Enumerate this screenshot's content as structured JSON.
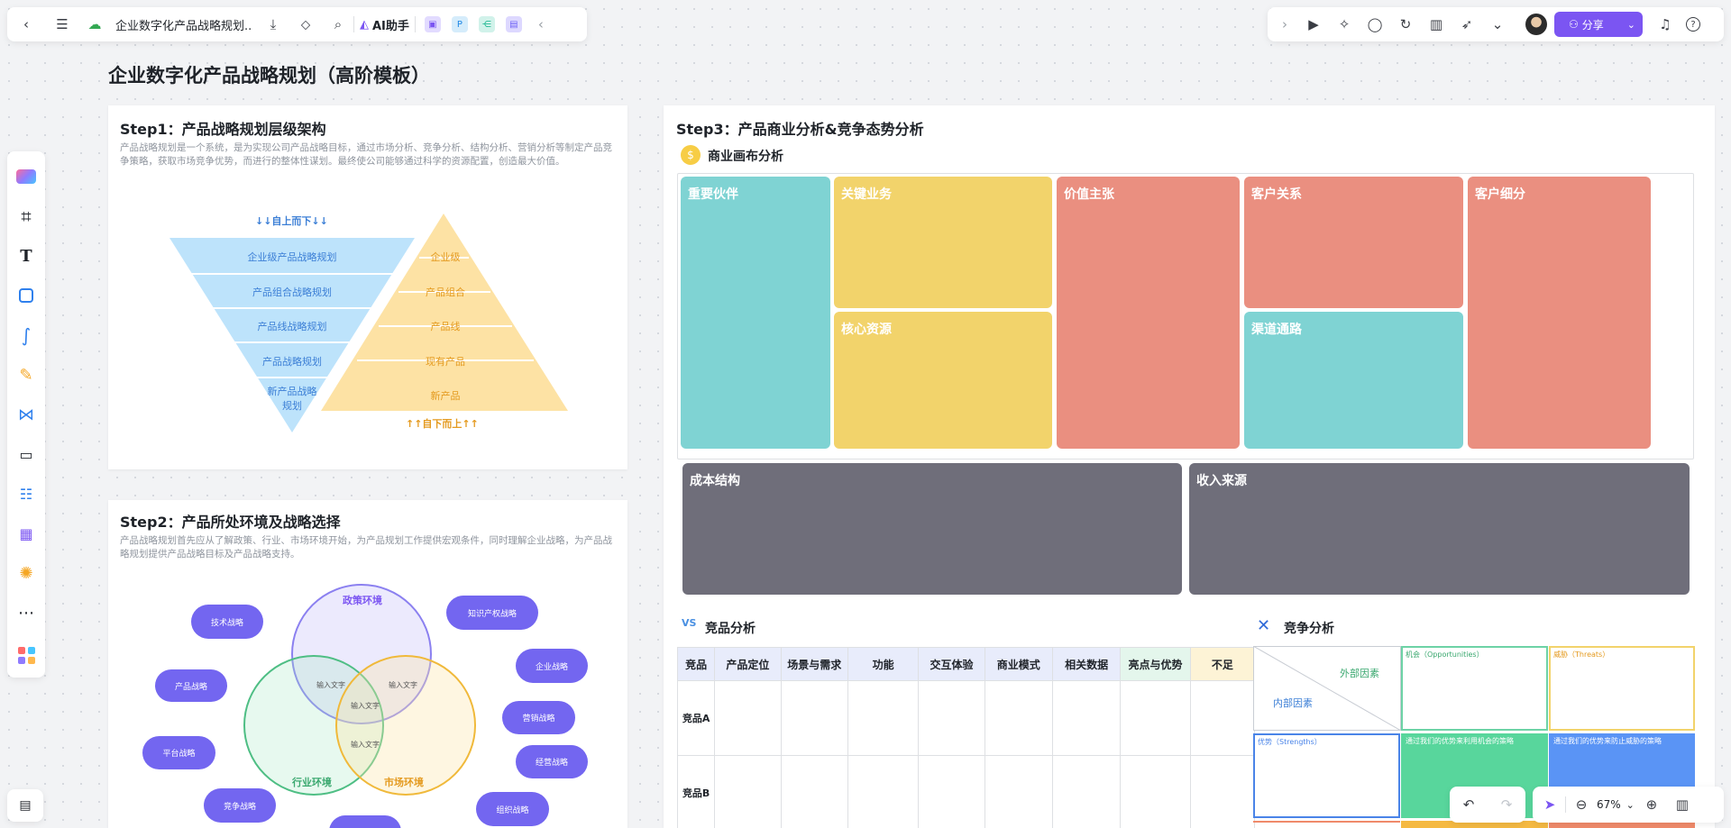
{
  "toolbar": {
    "doc_title": "企业数字化产品战略规划...",
    "ai_label": "AI助手",
    "share_label": "分享"
  },
  "page_title": "企业数字化产品战略规划（高阶模板）",
  "step1": {
    "title": "Step1：产品战略规划层级架构",
    "desc": "产品战略规划是一个系统，是为实现公司产品战略目标，通过市场分析、竞争分析、结构分析、营销分析等制定产品竞争策略，获取市场竞争优势，而进行的整体性谋划。最终使公司能够通过科学的资源配置，创造最大价值。",
    "top_down": "↓↓自上而下↓↓",
    "bottom_up": "↑↑自下而上↑↑",
    "inverted": [
      "企业级产品战略规划",
      "产品组合战略规划",
      "产品线战略规划",
      "产品战略规划",
      "新产品战略",
      "规划"
    ],
    "pyramid": [
      "企业级",
      "产品组合",
      "产品线",
      "现有产品",
      "新产品"
    ]
  },
  "step2": {
    "title": "Step2：产品所处环境及战略选择",
    "desc": "产品战略规划首先应从了解政策、行业、市场环境开始，为产品规划工作提供宏观条件，同时理解企业战略，为产品战略规划提供产品战略目标及产品战略支持。",
    "circles": [
      "政策环境",
      "行业环境",
      "市场环境"
    ],
    "inner": [
      "输入文字",
      "输入文字",
      "输入文字",
      "输入文字"
    ],
    "pills": [
      "技术战略",
      "知识产权战略",
      "产品战略",
      "企业战略",
      "营销战略",
      "平台战略",
      "经营战略",
      "竞争战略",
      "组织战略",
      ""
    ]
  },
  "step3": {
    "title": "Step3：产品商业分析&竞争态势分析",
    "canvas_title": "商业画布分析",
    "canvas": {
      "partners": "重要伙伴",
      "activities": "关键业务",
      "resources": "核心资源",
      "value": "价值主张",
      "relations": "客户关系",
      "channels": "渠道通路",
      "segments": "客户细分",
      "cost": "成本结构",
      "revenue": "收入来源"
    },
    "competitor_title": "竞品分析",
    "competitor_headers": [
      "竞品",
      "产品定位",
      "场景与需求",
      "功能",
      "交互体验",
      "商业模式",
      "相关数据",
      "亮点与优势",
      "不足"
    ],
    "competitor_rows": [
      "竞品A",
      "竞品B"
    ],
    "competition_title": "竞争分析",
    "swot": {
      "external": "外部因素",
      "internal": "内部因素",
      "opportunities": "机会（Opportunities）",
      "threats": "威胁（Threats）",
      "strengths": "优势（Strengths）",
      "so": "通过我们的优势来利用机会的策略",
      "st": "通过我们的优势来防止威胁的策略"
    }
  },
  "zoom": {
    "level": "67%"
  },
  "colors": {
    "teal": "#7fd3d3",
    "yellow": "#f2d36b",
    "salmon": "#ea8f80",
    "slate": "#6f6e7a",
    "accent": "#7b55f2"
  }
}
